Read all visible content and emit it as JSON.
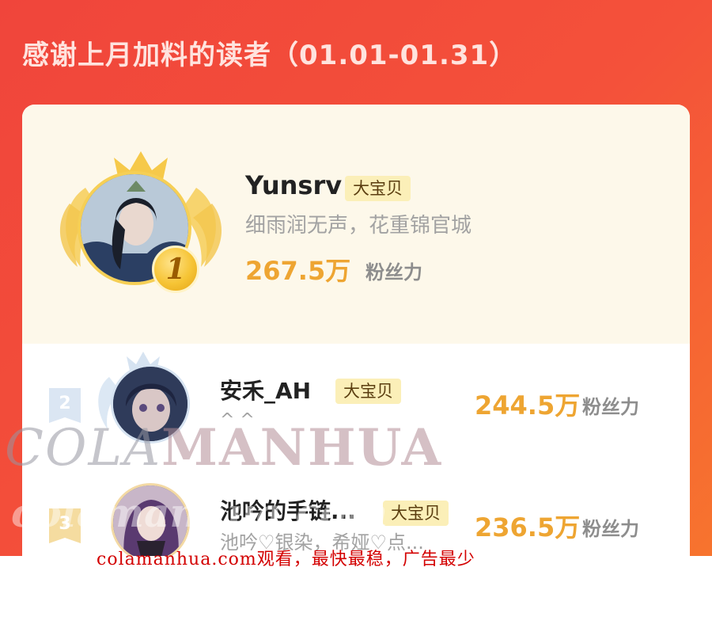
{
  "header": {
    "title": "感谢上月加料的读者（01.01-01.31）"
  },
  "colors": {
    "accent": "#f0453b",
    "score": "#eea532",
    "tag_bg": "#fbefb8",
    "first_bg": "#fdf8ea"
  },
  "ranking": [
    {
      "rank": "1",
      "name": "Yunsrv",
      "tag": "大宝贝",
      "motto": "细雨润无声，花重锦官城",
      "score": "267.5万",
      "unit": "粉丝力"
    },
    {
      "rank": "2",
      "name": "安禾_AH",
      "tag": "大宝贝",
      "motto": "^ ^",
      "score": "244.5万",
      "unit": "粉丝力"
    },
    {
      "rank": "3",
      "name": "池吟的手链...",
      "tag": "大宝贝",
      "motto": "池吟♡银染，希娅♡点...",
      "score": "236.5万",
      "unit": "粉丝力"
    }
  ],
  "watermark": {
    "big_part1": "COLA",
    "big_part2": "MANHUA",
    "mid": "colamanhua.com",
    "line": "colamanhua.com观看，最快最稳，广告最少"
  },
  "icons": [
    "crown-icon",
    "laurel-wing-icon",
    "avatar-image",
    "rank-medal-icon",
    "rank-ribbon-icon"
  ]
}
